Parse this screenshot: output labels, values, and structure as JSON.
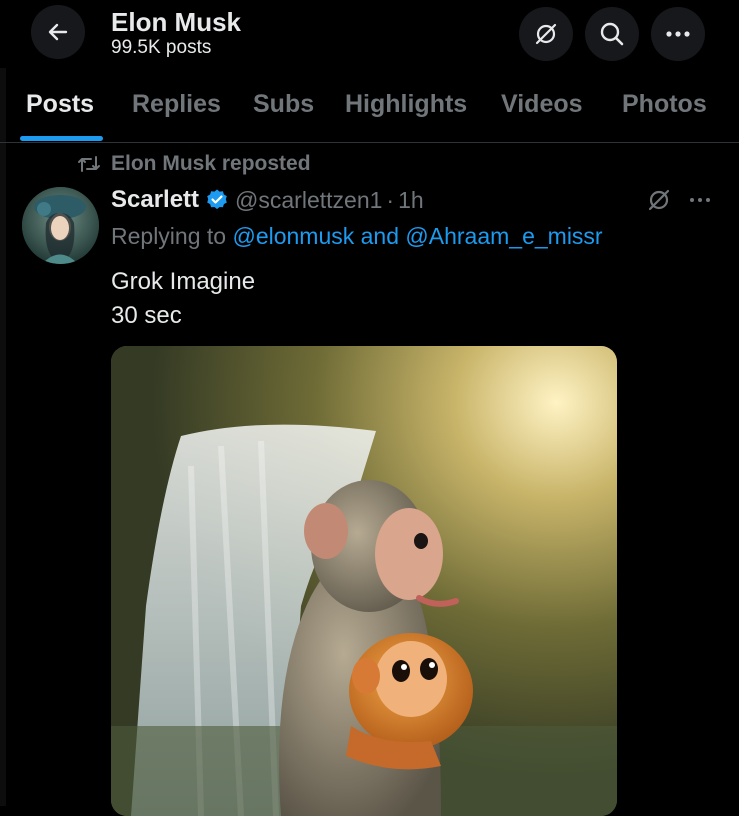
{
  "header": {
    "title": "Elon Musk",
    "subtitle": "99.5K posts",
    "back_icon": "arrow-left-icon",
    "grok_icon": "grok-icon",
    "search_icon": "search-icon",
    "more_icon": "more-icon"
  },
  "tabs": [
    {
      "label": "Posts",
      "active": true
    },
    {
      "label": "Replies",
      "active": false
    },
    {
      "label": "Subs",
      "active": false
    },
    {
      "label": "Highlights",
      "active": false
    },
    {
      "label": "Videos",
      "active": false
    },
    {
      "label": "Photos",
      "active": false
    }
  ],
  "post": {
    "repost_label": "Elon Musk reposted",
    "author_name": "Scarlett",
    "verified": true,
    "handle": "@scarlettzen1",
    "separator": "·",
    "time": "1h",
    "reply_prefix": "Replying to",
    "reply_mentions": "@elonmusk and @Ahraam_e_missr",
    "text_line1": "Grok Imagine",
    "text_line2": "30 sec",
    "media_description": "image"
  },
  "colors": {
    "background": "#000000",
    "text_primary": "#e7e9ea",
    "text_secondary": "#71767b",
    "accent": "#1d9bf0"
  }
}
